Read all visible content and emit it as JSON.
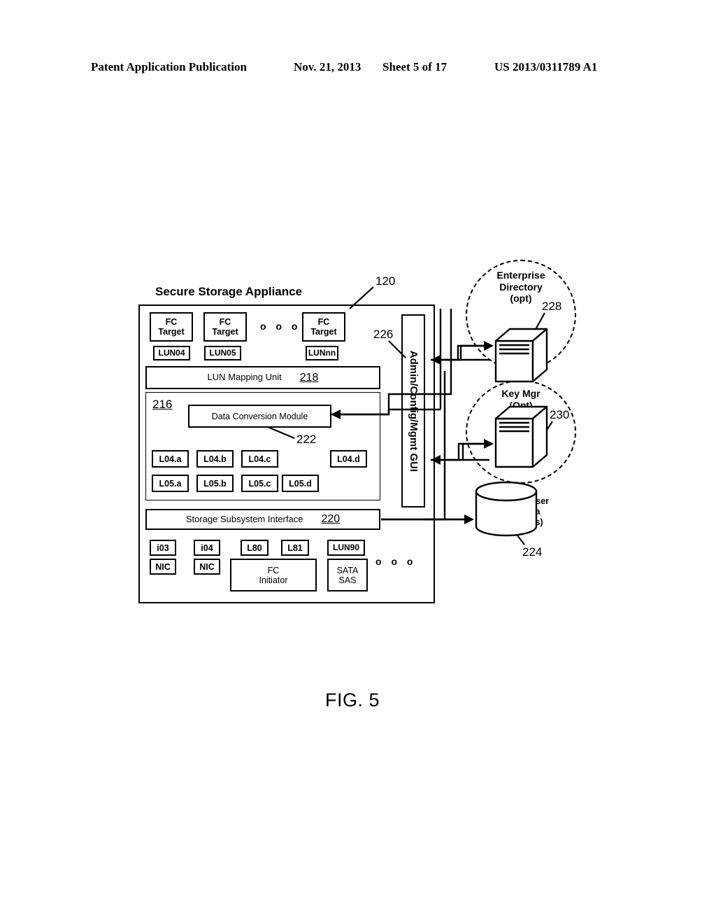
{
  "header": {
    "publication": "Patent Application Publication",
    "date": "Nov. 21, 2013",
    "sheet": "Sheet 5 of 17",
    "number": "US 2013/0311789 A1"
  },
  "figure": {
    "caption": "FIG. 5",
    "appliance_title": "Secure Storage Appliance"
  },
  "refs": {
    "appliance": "120",
    "gui": "226",
    "enterprise_directory": "228",
    "key_mgr": "230",
    "meta_data": "224",
    "lun_mapping_unit": "218",
    "secure_parser": "216",
    "data_conversion": "222",
    "storage_subsystem": "220"
  },
  "fc_targets": [
    {
      "line1": "FC",
      "line2": "Target",
      "lun": "LUN04"
    },
    {
      "line1": "FC",
      "line2": "Target",
      "lun": "LUN05"
    },
    {
      "line1": "FC",
      "line2": "Target",
      "lun": "LUNnn"
    }
  ],
  "ellipsis": "o o o",
  "lun_mapping": {
    "label": "LUN Mapping Unit",
    "ref": "218"
  },
  "data_conversion": {
    "label": "Data Conversion Module"
  },
  "shares_row1": [
    "L04.a",
    "L04.b",
    "L04.c",
    "L04.d"
  ],
  "shares_row2": [
    "L05.a",
    "L05.b",
    "L05.c",
    "L05.d"
  ],
  "storage_subsystem": {
    "label": "Storage Subsystem Interface",
    "ref": "220"
  },
  "initiators": {
    "i03": "i03",
    "i04": "i04",
    "nic1": "NIC",
    "nic2": "NIC",
    "l80": "L80",
    "l81": "L81",
    "fc_initiator_line1": "FC",
    "fc_initiator_line2": "Initiator",
    "lun90": "LUN90",
    "sata_line1": "SATA",
    "sata_line2": "SAS"
  },
  "gui": {
    "label": "Admin/Config/Mgmt GUI"
  },
  "enterprise_directory": {
    "line1": "Enterprise",
    "line2": "Directory",
    "line3": "(opt)",
    "icon": "server-icon"
  },
  "key_mgr": {
    "line1": "Key Mgr",
    "line2": "(Opt)",
    "icon": "server-icon"
  },
  "meta_data": {
    "line1": "Secure Parser",
    "line2": "Meta Data",
    "line3": "(mappings)",
    "icon": "database-cylinder-icon"
  },
  "colors": {
    "ink": "#000000",
    "paper": "#ffffff"
  }
}
